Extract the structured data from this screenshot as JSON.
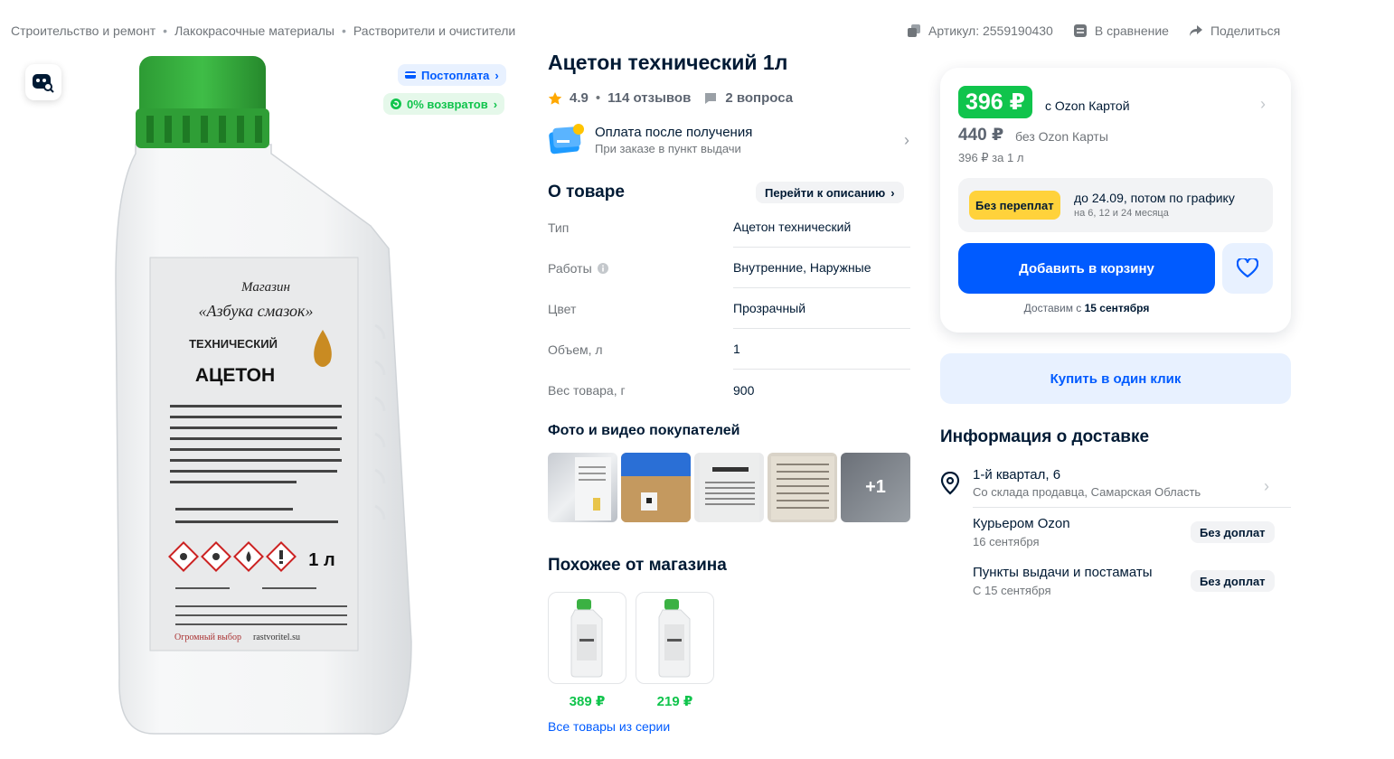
{
  "breadcrumbs": [
    "Строительство и ремонт",
    "Лакокрасочные материалы",
    "Растворители и очистители"
  ],
  "top_links": {
    "article": "Артикул: 2559190430",
    "compare": "В сравнение",
    "share": "Поделиться"
  },
  "gallery": {
    "badge_postpay": "Постоплата",
    "badge_returns": "0% возвратов",
    "label": {
      "shop": "Магазин",
      "brand": "«Азбука смазок»",
      "kind": "ТЕХНИЧЕСКИЙ",
      "name": "АЦЕТОН",
      "volume": "1 л",
      "site": "rastvoritel.su",
      "slogan": "Огромный выбор"
    }
  },
  "product": {
    "title": "Ацетон технический 1л",
    "rating": "4.9",
    "reviews": "114 отзывов",
    "questions": "2 вопроса"
  },
  "payment": {
    "title": "Оплата после получения",
    "subtitle": "При заказе в пункт выдачи"
  },
  "about": {
    "heading": "О товаре",
    "goto_label": "Перейти к описанию",
    "specs": [
      {
        "key": "Тип",
        "value": "Ацетон технический"
      },
      {
        "key": "Работы",
        "value": "Внутренние, Наружные"
      },
      {
        "key": "Цвет",
        "value": "Прозрачный"
      },
      {
        "key": "Объем, л",
        "value": "1"
      },
      {
        "key": "Вес товара, г",
        "value": "900"
      }
    ]
  },
  "photos": {
    "heading": "Фото и видео покупателей",
    "more": "+1"
  },
  "similar": {
    "heading": "Похожее от магазина",
    "items": [
      {
        "price": "389 ₽"
      },
      {
        "price": "219 ₽"
      }
    ],
    "all_link": "Все товары из серии"
  },
  "price": {
    "card_price": "396 ₽",
    "card_label": "с Ozon Картой",
    "regular_price": "440 ₽",
    "regular_label": "без Ozon Карты",
    "unit_price": "396 ₽ за 1 л"
  },
  "installment": {
    "badge": "Без переплат",
    "title": "до 24.09, потом по графику",
    "subtitle": "на 6, 12 и 24 месяца"
  },
  "cart": {
    "add_label": "Добавить в корзину",
    "deliver_prefix": "Доставим с ",
    "deliver_date": "15 сентября",
    "one_click": "Купить в один клик"
  },
  "delivery": {
    "heading": "Информация о доставке",
    "address": "1-й квартал, 6",
    "address_sub": "Со склада продавца, Самарская Область",
    "options": [
      {
        "title": "Курьером Ozon",
        "date": "16 сентября",
        "badge": "Без доплат"
      },
      {
        "title": "Пункты выдачи и постаматы",
        "date": "С 15 сентября",
        "badge": "Без доплат"
      }
    ]
  },
  "colors": {
    "accent": "#005bff",
    "green": "#10c44c",
    "yellow": "#ffd23b",
    "text": "#001a34",
    "muted": "#70757a"
  }
}
